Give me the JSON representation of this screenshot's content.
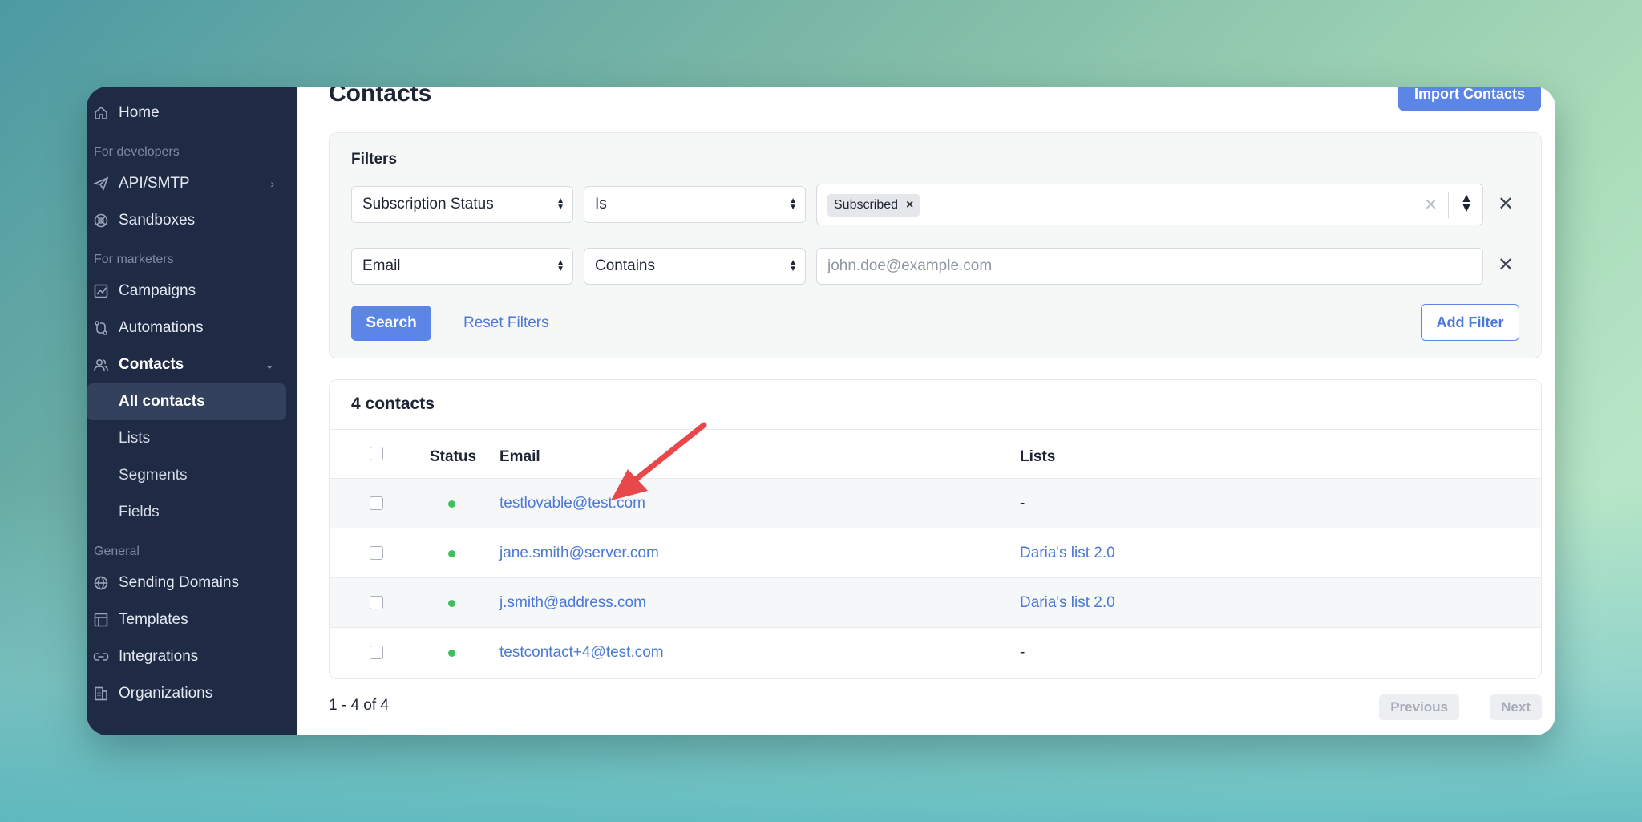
{
  "sidebar": {
    "home": "Home",
    "section_developers": "For developers",
    "api_smtp": "API/SMTP",
    "sandboxes": "Sandboxes",
    "section_marketers": "For marketers",
    "campaigns": "Campaigns",
    "automations": "Automations",
    "contacts": "Contacts",
    "sub": [
      "All contacts",
      "Lists",
      "Segments",
      "Fields"
    ],
    "section_general": "General",
    "sending_domains": "Sending Domains",
    "templates": "Templates",
    "integrations": "Integrations",
    "organizations": "Organizations"
  },
  "header": {
    "title": "Contacts",
    "import_label": "Import Contacts"
  },
  "filters": {
    "title": "Filters",
    "row1": {
      "field": "Subscription Status",
      "operator": "Is",
      "chip": "Subscribed"
    },
    "row2": {
      "field": "Email",
      "operator": "Contains",
      "placeholder": "john.doe@example.com"
    },
    "search_label": "Search",
    "reset_label": "Reset Filters",
    "add_label": "Add Filter"
  },
  "table": {
    "count_label": "4 contacts",
    "columns": {
      "status": "Status",
      "email": "Email",
      "lists": "Lists"
    },
    "rows": [
      {
        "email": "testlovable@test.com",
        "lists": "-"
      },
      {
        "email": "jane.smith@server.com",
        "lists": "Daria's list 2.0"
      },
      {
        "email": "j.smith@address.com",
        "lists": "Daria's list 2.0"
      },
      {
        "email": "testcontact+4@test.com",
        "lists": "-"
      }
    ]
  },
  "pagination": {
    "summary": "1 - 4 of 4",
    "previous_label": "Previous",
    "next_label": "Next"
  },
  "colors": {
    "sidebar_bg": "#1f2a44",
    "accent": "#5c86e6",
    "status_active": "#3fc05e",
    "annotation_arrow": "#e8484a"
  }
}
